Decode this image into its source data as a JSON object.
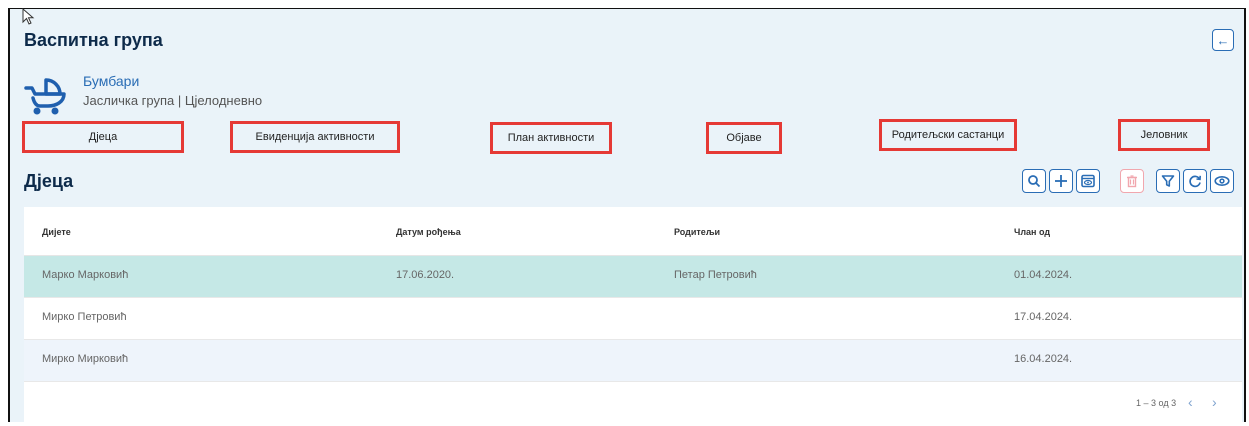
{
  "page": {
    "title": "Васпитна група"
  },
  "group": {
    "name": "Бумбари",
    "subtitle": "Јасличка група | Цјелодневно"
  },
  "tabs": [
    {
      "label": "Дјеца"
    },
    {
      "label": "Евиденција активности"
    },
    {
      "label": "План активности"
    },
    {
      "label": "Објаве"
    },
    {
      "label": "Родитељски састанци"
    },
    {
      "label": "Јеловник"
    }
  ],
  "section": {
    "title": "Дјеца"
  },
  "toolbar": [
    "search-icon",
    "add-icon",
    "preview-icon",
    "delete-icon",
    "filter-icon",
    "refresh-icon",
    "view-icon"
  ],
  "table": {
    "columns": [
      "Дијете",
      "Датум рођења",
      "Родитељи",
      "Члан од"
    ],
    "rows": [
      [
        "Марко Марковић",
        "17.06.2020.",
        "Петар Петровић",
        "01.04.2024."
      ],
      [
        "Мирко Петровић",
        "",
        "",
        "17.04.2024."
      ],
      [
        "Мирко Мирковић",
        "",
        "",
        "16.04.2024."
      ]
    ]
  },
  "pagination": {
    "text": "1 – 3 од 3"
  },
  "colors": {
    "accent": "#2a6db5",
    "selected_row": "#c5e8e6",
    "highlight_border": "#e53935",
    "title": "#0d2a4a"
  }
}
